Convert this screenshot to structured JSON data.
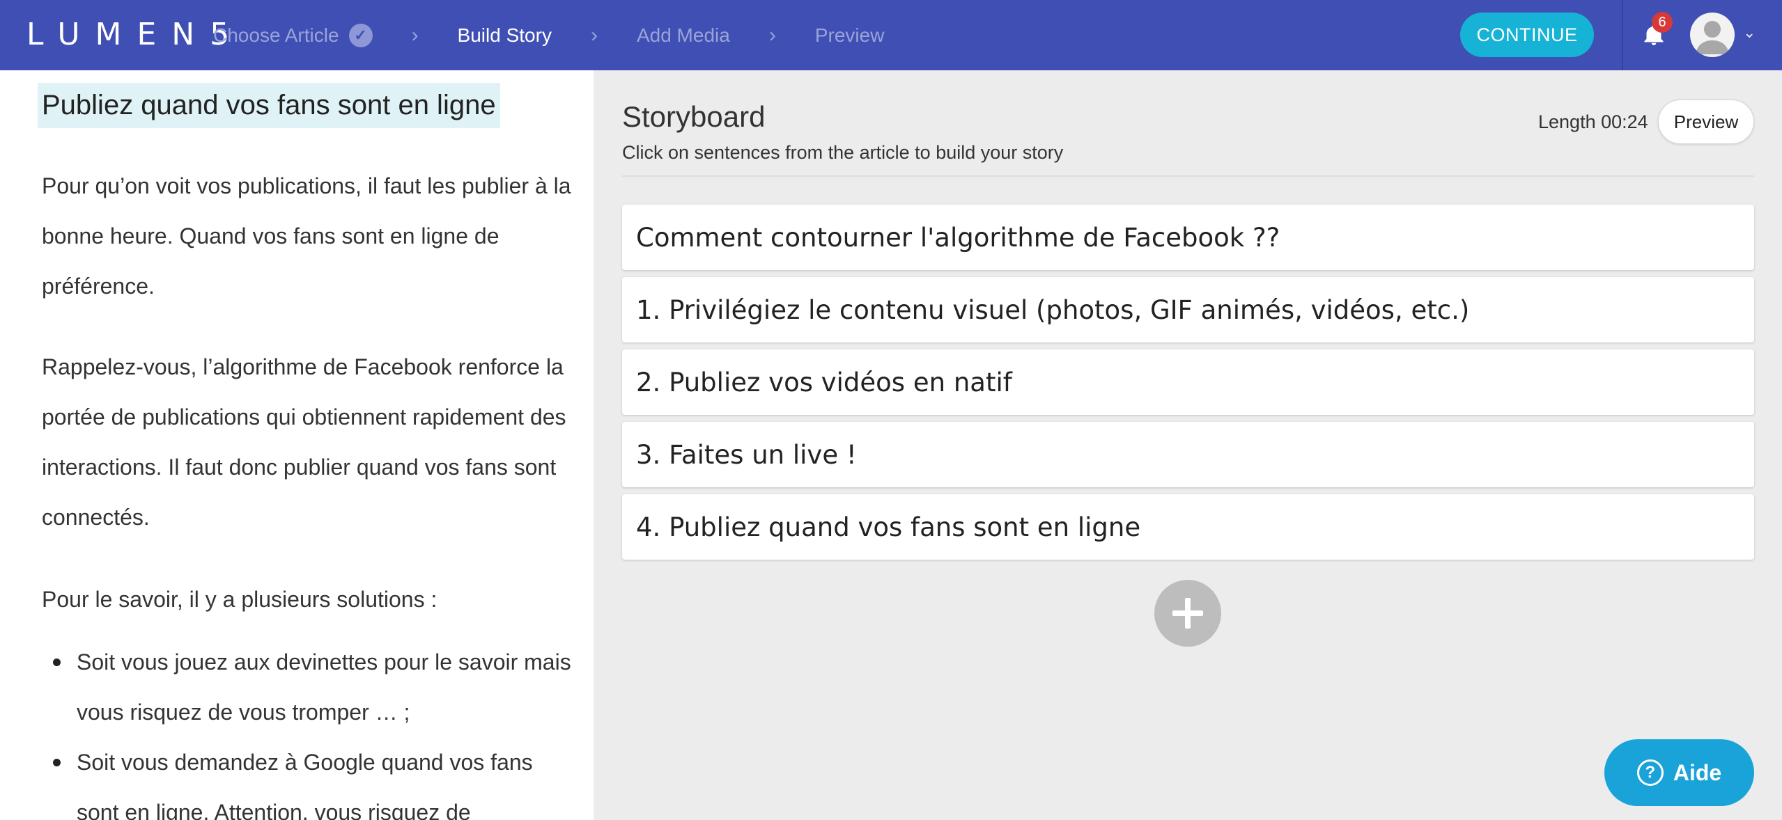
{
  "app": {
    "logo_text": "LUMEN5"
  },
  "nav": {
    "steps": [
      {
        "label": "Choose Article",
        "state": "done"
      },
      {
        "label": "Build Story",
        "state": "active"
      },
      {
        "label": "Add Media",
        "state": "pending"
      },
      {
        "label": "Preview",
        "state": "pending"
      }
    ],
    "continue_label": "CONTINUE",
    "notification_count": "6",
    "icons": {
      "bell": "bell-icon",
      "avatar": "user-avatar",
      "caret": "chevron-down-icon",
      "check": "check-icon"
    }
  },
  "article": {
    "title": "Publiez quand vos fans sont en ligne",
    "paragraphs": [
      "Pour qu’on voit vos publications, il faut les publier à la bonne heure.  Quand vos fans sont en ligne de préférence.",
      "Rappelez-vous, l’algorithme de Facebook renforce la portée de publications qui obtiennent rapidement des interactions.  Il faut donc publier quand vos fans sont connectés.",
      "Pour le savoir, il y a plusieurs solutions :"
    ],
    "bullets": [
      "Soit vous jouez aux devinettes pour le savoir mais vous risquez de vous tromper … ;",
      "Soit vous demandez à Google quand vos fans sont en ligne.  Attention, vous risquez de"
    ]
  },
  "storyboard": {
    "title": "Storyboard",
    "subtitle": "Click on sentences from the article to build your story",
    "length_label": "Length 00:24",
    "preview_label": "Preview",
    "cards": [
      "Comment contourner l'algorithme de Facebook ??",
      "1. Privilégiez le contenu visuel (photos, GIF animés, vidéos, etc.)",
      "2. Publiez vos vidéos en natif",
      "3. Faites un live !",
      "4. Publiez quand vos fans sont en ligne"
    ],
    "add_icon": "plus-icon"
  },
  "help": {
    "label": "Aide",
    "icon": "question-icon"
  },
  "colors": {
    "nav_bg": "#3f4fb3",
    "accent": "#17b3d6",
    "help": "#1aa3d8",
    "badge": "#d93838"
  }
}
